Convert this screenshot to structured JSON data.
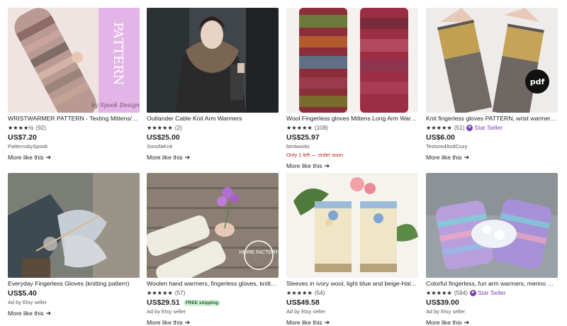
{
  "listings": [
    {
      "title": "WRISTWARMER PATTERN - Texting Mittens/Fingerless Gloves",
      "stars": "★★★★½",
      "reviews": "(92)",
      "price": "US$7.20",
      "shop": "PatternsbySpook",
      "more": "More like this",
      "image_text": "PATTERN",
      "image_caption": "by Spook Designs"
    },
    {
      "title": "Outlander Cable Knit Arm Warmers",
      "stars": "★★★★★",
      "reviews": "(2)",
      "price": "US$25.00",
      "shop": "SonofaKnit",
      "more": "More like this"
    },
    {
      "title": "Wool Fingerless gloves Mittens Long Arm Warmers",
      "stars": "★★★★★",
      "reviews": "(108)",
      "price": "US$25.97",
      "shop": "bimiworks",
      "stock": "Only 1 left — order soon",
      "more": "More like this"
    },
    {
      "title": "Knit fingerless gloves PATTERN, wrist warmers knitting",
      "stars": "★★★★★",
      "reviews": "(51)",
      "star_seller": "Star Seller",
      "price": "US$6.00",
      "shop": "TexturedAndCozy",
      "more": "More like this",
      "image_text": "pdf"
    },
    {
      "title": "Everyday Fingerless Gloves (knitting pattern)",
      "price": "US$5.40",
      "shop": "Ad by Etsy seller",
      "more": "More like this"
    },
    {
      "title": "Woolen hand warmers, fingerless gloves, knitted mittens",
      "stars": "★★★★★",
      "reviews": "(57)",
      "price": "US$29.51",
      "free_shipping": "FREE shipping",
      "shop": "Ad by Etsy seller",
      "more": "More like this",
      "image_text": "HOME FACTORY"
    },
    {
      "title": "Sleeves in ivory wool, light blue and beige-Half gloves",
      "stars": "★★★★★",
      "reviews": "(54)",
      "price": "US$49.58",
      "shop": "Ad by Etsy seller",
      "more": "More like this"
    },
    {
      "title": "Colorful fingerless, fun arm warmers, merino wool",
      "stars": "★★★★★",
      "reviews": "(594)",
      "star_seller": "Star Seller",
      "price": "US$39.00",
      "shop": "Ad by Etsy seller",
      "more": "More like this"
    }
  ]
}
